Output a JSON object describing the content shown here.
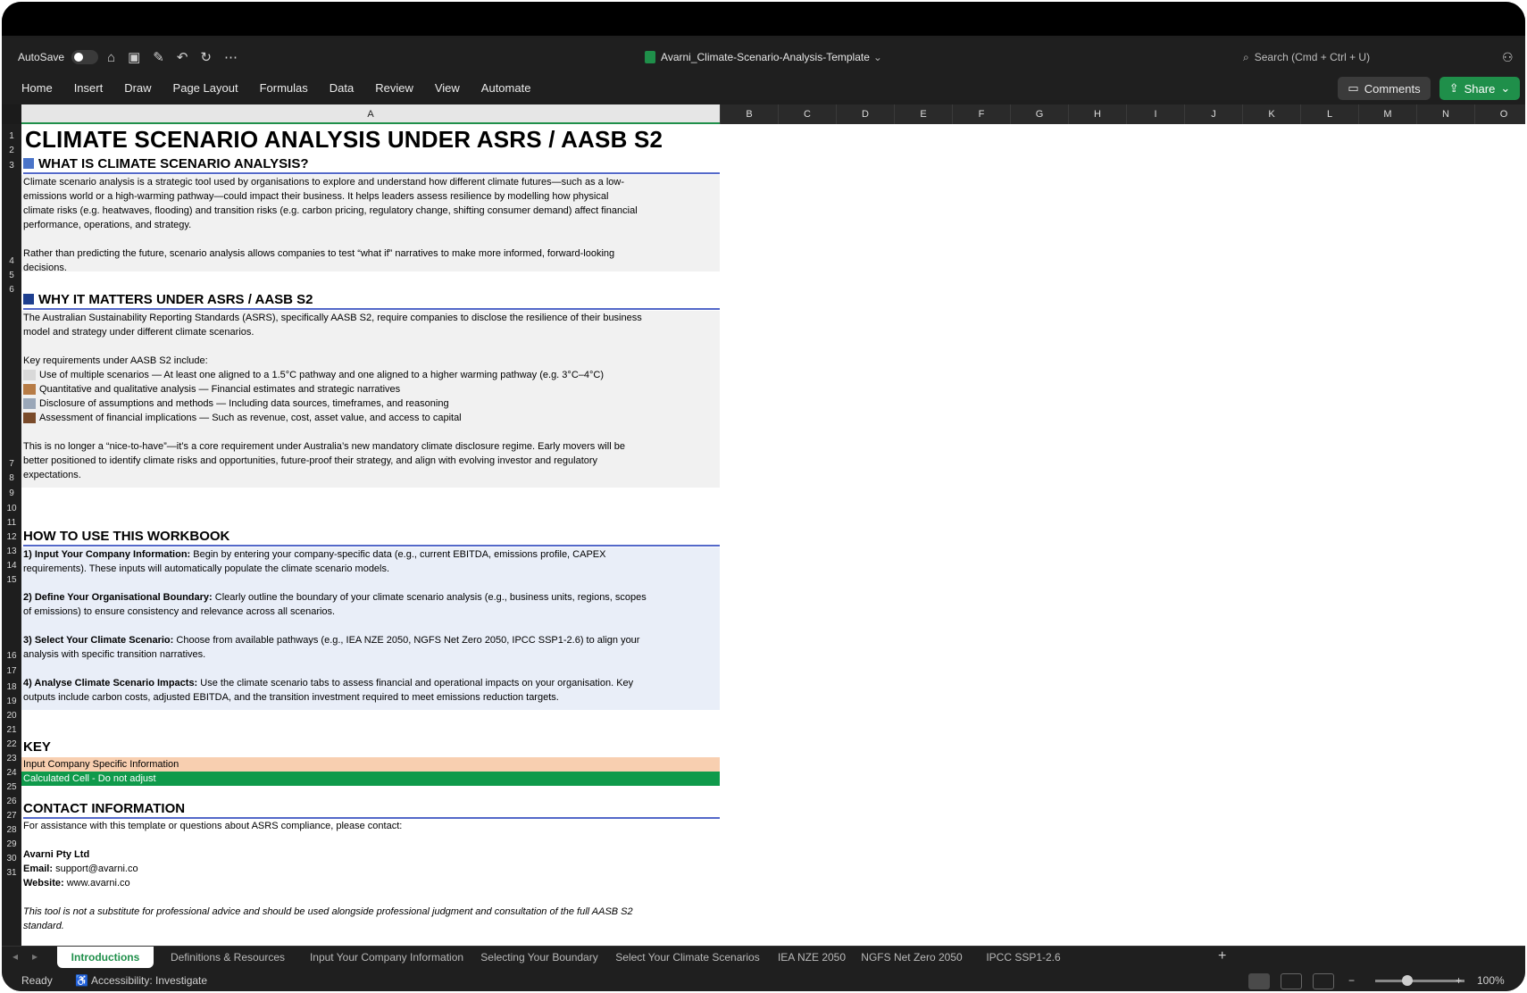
{
  "titlebar": {
    "autosave": "AutoSave",
    "document": "Avarni_Climate-Scenario-Analysis-Template",
    "search": "Search (Cmd + Ctrl + U)"
  },
  "ribbon": {
    "tabs": [
      "Home",
      "Insert",
      "Draw",
      "Page Layout",
      "Formulas",
      "Data",
      "Review",
      "View",
      "Automate"
    ],
    "comments": "Comments",
    "share": "Share"
  },
  "columns": [
    "A",
    "B",
    "C",
    "D",
    "E",
    "F",
    "G",
    "H",
    "I",
    "J",
    "K",
    "L",
    "M",
    "N",
    "O"
  ],
  "rows": [
    "1",
    "2",
    "3",
    "4",
    "5",
    "6",
    "7",
    "8",
    "9",
    "10",
    "11",
    "12",
    "13",
    "14",
    "15",
    "16",
    "17",
    "18",
    "19",
    "20",
    "21",
    "22",
    "23",
    "24",
    "25",
    "26",
    "27",
    "28",
    "29",
    "30",
    "31"
  ],
  "content": {
    "title": "CLIMATE SCENARIO ANALYSIS UNDER ASRS / AASB S2",
    "s1_heading": "WHAT IS CLIMATE SCENARIO ANALYSIS?",
    "s1_p1a": "Climate scenario analysis is a strategic tool used by organisations to explore and understand how different climate futures—such as a low-",
    "s1_p1b": "emissions world or a high-warming pathway—could impact their business. It helps leaders assess resilience by modelling how physical",
    "s1_p1c": "climate risks (e.g. heatwaves, flooding) and transition risks (e.g. carbon pricing, regulatory change, shifting consumer demand) affect financial",
    "s1_p1d": "performance, operations, and strategy.",
    "s1_p2a": "Rather than predicting the future, scenario analysis allows companies to test “what if” narratives to make more informed, forward-looking",
    "s1_p2b": "decisions.",
    "s2_heading": "WHY IT MATTERS UNDER ASRS / AASB S2",
    "s2_p1a": "The Australian Sustainability Reporting Standards (ASRS), specifically AASB S2, require companies to disclose the resilience of their business",
    "s2_p1b": "model and strategy under different climate scenarios.",
    "s2_req": "Key requirements under AASB S2 include:",
    "s2_items": [
      "Use of multiple scenarios — At least one aligned to a 1.5°C pathway and one aligned to a higher warming pathway (e.g. 3°C–4°C)",
      "Quantitative and qualitative analysis — Financial estimates and strategic narratives",
      "Disclosure of assumptions and methods — Including data sources, timeframes, and reasoning",
      "Assessment of financial implications — Such as revenue, cost, asset value, and access to capital"
    ],
    "s2_p3a": "This is no longer a “nice-to-have”—it’s a core requirement under Australia’s new mandatory climate disclosure regime. Early movers will be",
    "s2_p3b": "better positioned to identify climate risks and opportunities, future-proof their strategy, and align with evolving investor and regulatory",
    "s2_p3c": "expectations.",
    "s3_heading": "HOW TO USE THIS WORKBOOK",
    "step1_b": "1) Input Your Company Information:",
    "step1_ta": " Begin by entering your company-specific data (e.g., current EBITDA, emissions profile, CAPEX",
    "step1_tb": "requirements). These inputs will automatically populate the climate scenario models.",
    "step2_b": "2) Define Your Organisational Boundary:",
    "step2_ta": " Clearly outline the boundary of your climate scenario analysis (e.g., business units, regions, scopes",
    "step2_tb": "of emissions) to ensure consistency and relevance across all scenarios.",
    "step3_b": "3) Select Your Climate Scenario:",
    "step3_ta": " Choose from available pathways (e.g., IEA NZE 2050, NGFS Net Zero 2050, IPCC SSP1-2.6) to align your",
    "step3_tb": "analysis with specific transition narratives.",
    "step4_b": "4) Analyse Climate Scenario Impacts:",
    "step4_ta": " Use the climate scenario tabs to assess financial and operational impacts on your organisation. Key",
    "step4_tb": "outputs include carbon costs, adjusted EBITDA, and the transition investment required to meet emissions reduction targets.",
    "key_heading": "KEY",
    "key_input": "Input Company Specific Information",
    "key_calc": "Calculated Cell - Do not adjust",
    "contact_heading": "CONTACT INFORMATION",
    "contact_intro": "For assistance with this template or questions about ASRS compliance, please contact:",
    "company": "Avarni Pty Ltd",
    "email_label": "Email:",
    "email": " support@avarni.co",
    "website_label": "Website:",
    "website": " www.avarni.co",
    "disclaimer_a": "This tool is not a substitute for professional advice and should be used alongside professional judgment and consultation of the full AASB S2",
    "disclaimer_b": "standard."
  },
  "sheet_tabs": [
    "Introductions",
    "Definitions & Resources",
    "Input Your Company Information",
    "Selecting Your Boundary",
    "Select Your Climate Scenarios",
    "IEA NZE 2050",
    "NGFS Net Zero 2050",
    "IPCC SSP1-2.6"
  ],
  "status": {
    "ready": "Ready",
    "accessibility": "Accessibility: Investigate",
    "zoom": "100%"
  },
  "colors": {
    "accent_green": "#1f8f4a",
    "heading_rule": "#5368c9",
    "key_input": "#f8cfb0",
    "key_calc": "#0f9a4b"
  }
}
